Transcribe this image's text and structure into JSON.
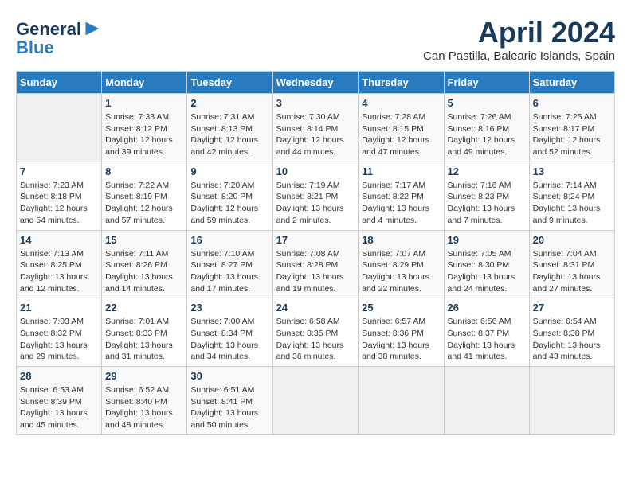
{
  "header": {
    "logo_line1": "General",
    "logo_line2": "Blue",
    "month": "April 2024",
    "location": "Can Pastilla, Balearic Islands, Spain"
  },
  "days_of_week": [
    "Sunday",
    "Monday",
    "Tuesday",
    "Wednesday",
    "Thursday",
    "Friday",
    "Saturday"
  ],
  "weeks": [
    [
      {
        "day": "",
        "info": ""
      },
      {
        "day": "1",
        "info": "Sunrise: 7:33 AM\nSunset: 8:12 PM\nDaylight: 12 hours\nand 39 minutes."
      },
      {
        "day": "2",
        "info": "Sunrise: 7:31 AM\nSunset: 8:13 PM\nDaylight: 12 hours\nand 42 minutes."
      },
      {
        "day": "3",
        "info": "Sunrise: 7:30 AM\nSunset: 8:14 PM\nDaylight: 12 hours\nand 44 minutes."
      },
      {
        "day": "4",
        "info": "Sunrise: 7:28 AM\nSunset: 8:15 PM\nDaylight: 12 hours\nand 47 minutes."
      },
      {
        "day": "5",
        "info": "Sunrise: 7:26 AM\nSunset: 8:16 PM\nDaylight: 12 hours\nand 49 minutes."
      },
      {
        "day": "6",
        "info": "Sunrise: 7:25 AM\nSunset: 8:17 PM\nDaylight: 12 hours\nand 52 minutes."
      }
    ],
    [
      {
        "day": "7",
        "info": "Sunrise: 7:23 AM\nSunset: 8:18 PM\nDaylight: 12 hours\nand 54 minutes."
      },
      {
        "day": "8",
        "info": "Sunrise: 7:22 AM\nSunset: 8:19 PM\nDaylight: 12 hours\nand 57 minutes."
      },
      {
        "day": "9",
        "info": "Sunrise: 7:20 AM\nSunset: 8:20 PM\nDaylight: 12 hours\nand 59 minutes."
      },
      {
        "day": "10",
        "info": "Sunrise: 7:19 AM\nSunset: 8:21 PM\nDaylight: 13 hours\nand 2 minutes."
      },
      {
        "day": "11",
        "info": "Sunrise: 7:17 AM\nSunset: 8:22 PM\nDaylight: 13 hours\nand 4 minutes."
      },
      {
        "day": "12",
        "info": "Sunrise: 7:16 AM\nSunset: 8:23 PM\nDaylight: 13 hours\nand 7 minutes."
      },
      {
        "day": "13",
        "info": "Sunrise: 7:14 AM\nSunset: 8:24 PM\nDaylight: 13 hours\nand 9 minutes."
      }
    ],
    [
      {
        "day": "14",
        "info": "Sunrise: 7:13 AM\nSunset: 8:25 PM\nDaylight: 13 hours\nand 12 minutes."
      },
      {
        "day": "15",
        "info": "Sunrise: 7:11 AM\nSunset: 8:26 PM\nDaylight: 13 hours\nand 14 minutes."
      },
      {
        "day": "16",
        "info": "Sunrise: 7:10 AM\nSunset: 8:27 PM\nDaylight: 13 hours\nand 17 minutes."
      },
      {
        "day": "17",
        "info": "Sunrise: 7:08 AM\nSunset: 8:28 PM\nDaylight: 13 hours\nand 19 minutes."
      },
      {
        "day": "18",
        "info": "Sunrise: 7:07 AM\nSunset: 8:29 PM\nDaylight: 13 hours\nand 22 minutes."
      },
      {
        "day": "19",
        "info": "Sunrise: 7:05 AM\nSunset: 8:30 PM\nDaylight: 13 hours\nand 24 minutes."
      },
      {
        "day": "20",
        "info": "Sunrise: 7:04 AM\nSunset: 8:31 PM\nDaylight: 13 hours\nand 27 minutes."
      }
    ],
    [
      {
        "day": "21",
        "info": "Sunrise: 7:03 AM\nSunset: 8:32 PM\nDaylight: 13 hours\nand 29 minutes."
      },
      {
        "day": "22",
        "info": "Sunrise: 7:01 AM\nSunset: 8:33 PM\nDaylight: 13 hours\nand 31 minutes."
      },
      {
        "day": "23",
        "info": "Sunrise: 7:00 AM\nSunset: 8:34 PM\nDaylight: 13 hours\nand 34 minutes."
      },
      {
        "day": "24",
        "info": "Sunrise: 6:58 AM\nSunset: 8:35 PM\nDaylight: 13 hours\nand 36 minutes."
      },
      {
        "day": "25",
        "info": "Sunrise: 6:57 AM\nSunset: 8:36 PM\nDaylight: 13 hours\nand 38 minutes."
      },
      {
        "day": "26",
        "info": "Sunrise: 6:56 AM\nSunset: 8:37 PM\nDaylight: 13 hours\nand 41 minutes."
      },
      {
        "day": "27",
        "info": "Sunrise: 6:54 AM\nSunset: 8:38 PM\nDaylight: 13 hours\nand 43 minutes."
      }
    ],
    [
      {
        "day": "28",
        "info": "Sunrise: 6:53 AM\nSunset: 8:39 PM\nDaylight: 13 hours\nand 45 minutes."
      },
      {
        "day": "29",
        "info": "Sunrise: 6:52 AM\nSunset: 8:40 PM\nDaylight: 13 hours\nand 48 minutes."
      },
      {
        "day": "30",
        "info": "Sunrise: 6:51 AM\nSunset: 8:41 PM\nDaylight: 13 hours\nand 50 minutes."
      },
      {
        "day": "",
        "info": ""
      },
      {
        "day": "",
        "info": ""
      },
      {
        "day": "",
        "info": ""
      },
      {
        "day": "",
        "info": ""
      }
    ]
  ]
}
